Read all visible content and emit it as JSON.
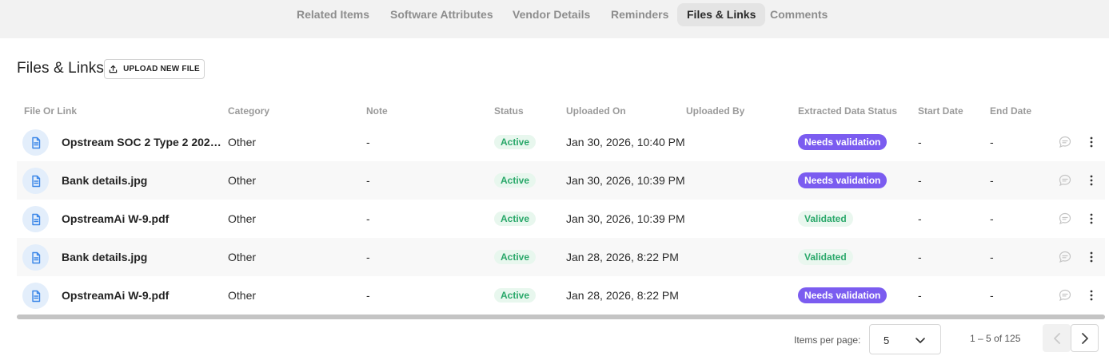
{
  "tabs": [
    {
      "label": "Related Items"
    },
    {
      "label": "Software Attributes"
    },
    {
      "label": "Vendor Details"
    },
    {
      "label": "Reminders"
    },
    {
      "label": "Files & Links",
      "active": true
    },
    {
      "label": "Comments"
    }
  ],
  "section": {
    "title": "Files & Links",
    "upload_label": "UPLOAD NEW FILE"
  },
  "table": {
    "headers": {
      "file": "File Or Link",
      "category": "Category",
      "note": "Note",
      "status": "Status",
      "uploaded_on": "Uploaded On",
      "uploaded_by": "Uploaded By",
      "extracted": "Extracted Data Status",
      "start": "Start Date",
      "end": "End Date"
    },
    "rows": [
      {
        "file": "Opstream SOC 2 Type 2 2025…",
        "category": "Other",
        "note": "-",
        "status": "Active",
        "uploaded_on": "Jan 30, 2026, 10:40 PM",
        "uploaded_by": "",
        "extracted": "Needs validation",
        "start": "-",
        "end": "-"
      },
      {
        "file": "Bank details.jpg",
        "category": "Other",
        "note": "-",
        "status": "Active",
        "uploaded_on": "Jan 30, 2026, 10:39 PM",
        "uploaded_by": "",
        "extracted": "Needs validation",
        "start": "-",
        "end": "-"
      },
      {
        "file": "OpstreamAi W-9.pdf",
        "category": "Other",
        "note": "-",
        "status": "Active",
        "uploaded_on": "Jan 30, 2026, 10:39 PM",
        "uploaded_by": "",
        "extracted": "Validated",
        "start": "-",
        "end": "-"
      },
      {
        "file": "Bank details.jpg",
        "category": "Other",
        "note": "-",
        "status": "Active",
        "uploaded_on": "Jan 28, 2026, 8:22 PM",
        "uploaded_by": "",
        "extracted": "Validated",
        "start": "-",
        "end": "-"
      },
      {
        "file": "OpstreamAi W-9.pdf",
        "category": "Other",
        "note": "-",
        "status": "Active",
        "uploaded_on": "Jan 28, 2026, 8:22 PM",
        "uploaded_by": "",
        "extracted": "Needs validation",
        "start": "-",
        "end": "-"
      }
    ]
  },
  "paginator": {
    "items_per_page_label": "Items per page:",
    "items_per_page_value": "5",
    "range_label": "1 – 5 of 125"
  },
  "icons": {
    "upload": "upload-icon",
    "file": "file-document-icon",
    "comment": "comment-icon",
    "kebab": "more-vertical-icon",
    "prev": "chevron-left-icon",
    "next": "chevron-right-icon",
    "dropdown": "chevron-down-icon"
  },
  "colors": {
    "needs_validation_bg": "#7b5cf0",
    "validated_text": "#2aa86a",
    "active_text": "#2aa86a",
    "file_icon": "#3a86e8"
  }
}
